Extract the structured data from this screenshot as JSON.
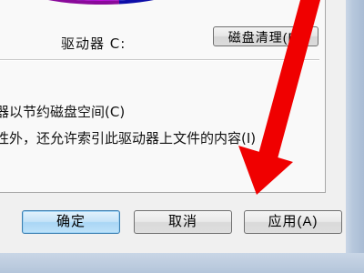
{
  "properties": {
    "drive_label": "驱动器 C:",
    "cleanup_button": "磁盘清理(D)",
    "compress_option": "器以节约磁盘空间(C)",
    "index_option": "性外，还允许索引此驱动器上文件的内容(I)"
  },
  "footer": {
    "ok_button": "确定",
    "cancel_button": "取消",
    "apply_button": "应用(A)"
  },
  "colors": {
    "pie_used": "#c010d8",
    "pie_free": "#1a1af0",
    "arrow": "#f00000",
    "ok_accent": "#3c7fb1"
  }
}
